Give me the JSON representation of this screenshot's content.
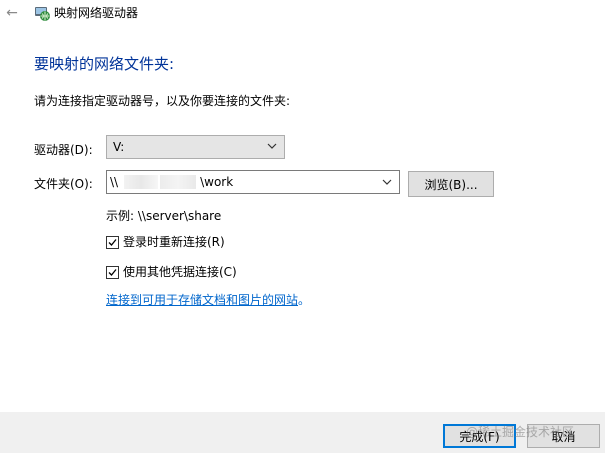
{
  "window": {
    "title": "映射网络驱动器",
    "back_icon": "back-arrow-icon",
    "title_icon": "network-drive-icon"
  },
  "main": {
    "heading": "要映射的网络文件夹:",
    "instruction": "请为连接指定驱动器号，以及你要连接的文件夹:",
    "drive_label": "驱动器(D):",
    "drive_value": "V:",
    "folder_label": "文件夹(O):",
    "folder_value_prefix": "\\\\",
    "folder_value_suffix": "\\work",
    "browse_label": "浏览(B)...",
    "example_text": "示例: \\\\server\\share",
    "reconnect_label": "登录时重新连接(R)",
    "reconnect_checked": true,
    "credentials_label": "使用其他凭据连接(C)",
    "credentials_checked": true,
    "link_text": "连接到可用于存储文档和图片的网站",
    "link_suffix": "。"
  },
  "footer": {
    "finish_label": "完成(F)",
    "cancel_label": "取消",
    "watermark": "@稀土掘金技术社区"
  },
  "colors": {
    "heading": "#003399",
    "link": "#0066cc",
    "footer_bg": "#f0f0f0",
    "default_button_border": "#0078d7"
  }
}
